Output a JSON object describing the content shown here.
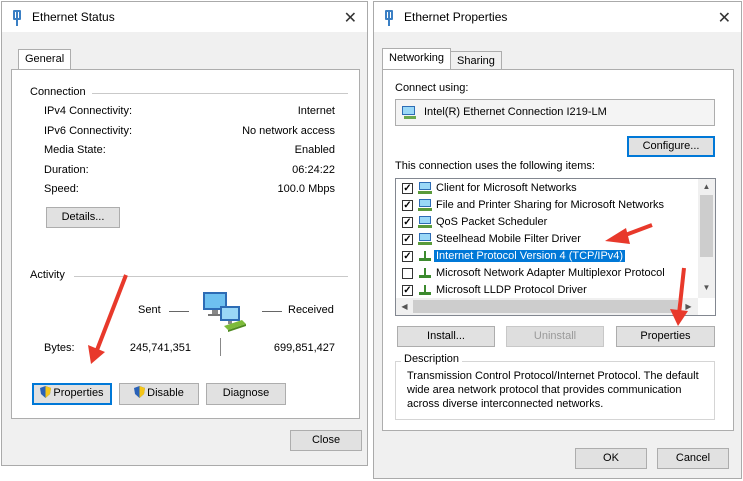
{
  "status_window": {
    "title": "Ethernet Status",
    "tab_label": "General",
    "connection_heading": "Connection",
    "rows": [
      {
        "label": "IPv4 Connectivity:",
        "value": "Internet"
      },
      {
        "label": "IPv6 Connectivity:",
        "value": "No network access"
      },
      {
        "label": "Media State:",
        "value": "Enabled"
      },
      {
        "label": "Duration:",
        "value": "06:24:22"
      },
      {
        "label": "Speed:",
        "value": "100.0 Mbps"
      }
    ],
    "details_button": "Details...",
    "activity_heading": "Activity",
    "sent_label": "Sent",
    "received_label": "Received",
    "bytes_label": "Bytes:",
    "bytes_sent": "245,741,351",
    "bytes_received": "699,851,427",
    "properties_button": "Properties",
    "disable_button": "Disable",
    "diagnose_button": "Diagnose",
    "close_button": "Close"
  },
  "props_window": {
    "title": "Ethernet Properties",
    "tabs": [
      "Networking",
      "Sharing"
    ],
    "connect_using_label": "Connect using:",
    "adapter_name": "Intel(R) Ethernet Connection I219-LM",
    "configure_button": "Configure...",
    "items_label": "This connection uses the following items:",
    "items": [
      {
        "label": "Client for Microsoft Networks",
        "checked": true,
        "icon": "network-client-icon"
      },
      {
        "label": "File and Printer Sharing for Microsoft Networks",
        "checked": true,
        "icon": "network-service-icon"
      },
      {
        "label": "QoS Packet Scheduler",
        "checked": true,
        "icon": "network-service-icon"
      },
      {
        "label": "Steelhead Mobile Filter Driver",
        "checked": true,
        "icon": "network-service-icon"
      },
      {
        "label": "Internet Protocol Version 4 (TCP/IPv4)",
        "checked": true,
        "icon": "protocol-icon",
        "selected": true
      },
      {
        "label": "Microsoft Network Adapter Multiplexor Protocol",
        "checked": false,
        "icon": "protocol-icon"
      },
      {
        "label": "Microsoft LLDP Protocol Driver",
        "checked": true,
        "icon": "protocol-icon"
      }
    ],
    "install_button": "Install...",
    "uninstall_button": "Uninstall",
    "properties_button": "Properties",
    "description_heading": "Description",
    "description_text": [
      "Transmission Control Protocol/Internet Protocol. The default",
      "wide area network protocol that provides communication",
      "across diverse interconnected networks."
    ],
    "ok_button": "OK",
    "cancel_button": "Cancel"
  },
  "colors": {
    "accent": "#0078d7",
    "annotation_arrow": "#e8392b"
  }
}
